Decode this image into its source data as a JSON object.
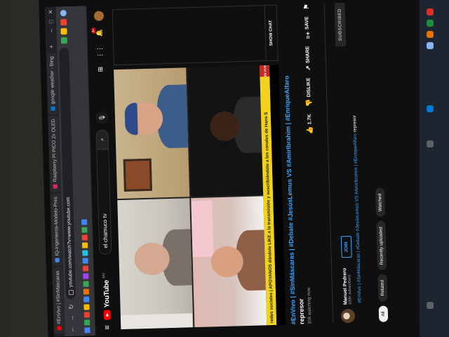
{
  "browser": {
    "tabs": [
      {
        "label": "#EnVivo | #SinMáscaras",
        "active": false
      },
      {
        "label": "IQ-Ingenieros-Modelo-Pres",
        "active": false
      },
      {
        "label": "Raspberry Pi PICO 2x OLED",
        "active": false
      },
      {
        "label": "google weather - Bing",
        "active": false
      },
      {
        "label": "",
        "active": true
      }
    ],
    "url": "youtube.com/watch?v=www.youtube.com",
    "new_tab": "+",
    "controls": {
      "minimize": "–",
      "maximize": "□",
      "close": "✕"
    },
    "bookmarks": [
      {
        "label": "",
        "color": "#4285f4"
      },
      {
        "label": "",
        "color": "#34a853"
      },
      {
        "label": "",
        "color": "#ea4335"
      },
      {
        "label": "",
        "color": "#fbbc05"
      },
      {
        "label": "",
        "color": "#4285f4"
      },
      {
        "label": "",
        "color": "#e8710a"
      },
      {
        "label": "",
        "color": "#34a853"
      },
      {
        "label": "",
        "color": "#a142f4"
      },
      {
        "label": "",
        "color": "#ea4335"
      },
      {
        "label": "",
        "color": "#4285f4"
      },
      {
        "label": "",
        "color": "#24c1e0"
      },
      {
        "label": "",
        "color": "#fbbc05"
      },
      {
        "label": "",
        "color": "#ea4335"
      },
      {
        "label": "",
        "color": "#34a853"
      },
      {
        "label": "",
        "color": "#4285f4"
      }
    ]
  },
  "youtube": {
    "logo_text": "YouTube",
    "country": "MX",
    "search_value": "el chamuco tv",
    "notifications": "9+",
    "icons": {
      "menu": "menu-icon",
      "search": "search-icon",
      "mic": "mic-icon",
      "create": "create-icon",
      "apps": "apps-icon",
      "bell": "bell-icon"
    }
  },
  "player": {
    "ticker_text": "redes sociales | APOYANOS dándole LIKE a la transmisión y suscribiéndote a los canales de Hans S",
    "ticker_badge": "EN VIVO"
  },
  "chat": {
    "show_chat": "SHOW CHAT"
  },
  "video": {
    "title_prefix": "#EnVivo | #SinMáscaras | #Debate #JesúsLemus VS #AmirIbrahim | #EnriqueAlfaro",
    "title_suffix": "represor",
    "views": "105 watching now",
    "likes": "1.7K",
    "dislike": "DISLIKE",
    "share": "SHARE",
    "save": "SAVE"
  },
  "channel": {
    "name": "Manuel Pedrero",
    "subscribers": "100K subscribers",
    "join": "JOIN",
    "subscribed": "SUBSCRIBED"
  },
  "description": {
    "tags": "#EnVivo | #SinMáscaras | #Debate #JesúsLemus VS #AmirIbrahim | #EnriqueAlfaro",
    "suffix": "represor"
  },
  "chips": [
    {
      "label": "All",
      "selected": true
    },
    {
      "label": "Related",
      "selected": false
    },
    {
      "label": "Recently uploaded",
      "selected": false
    },
    {
      "label": "Watched",
      "selected": false
    }
  ],
  "background_page": {
    "heading_fragment": "perties"
  }
}
